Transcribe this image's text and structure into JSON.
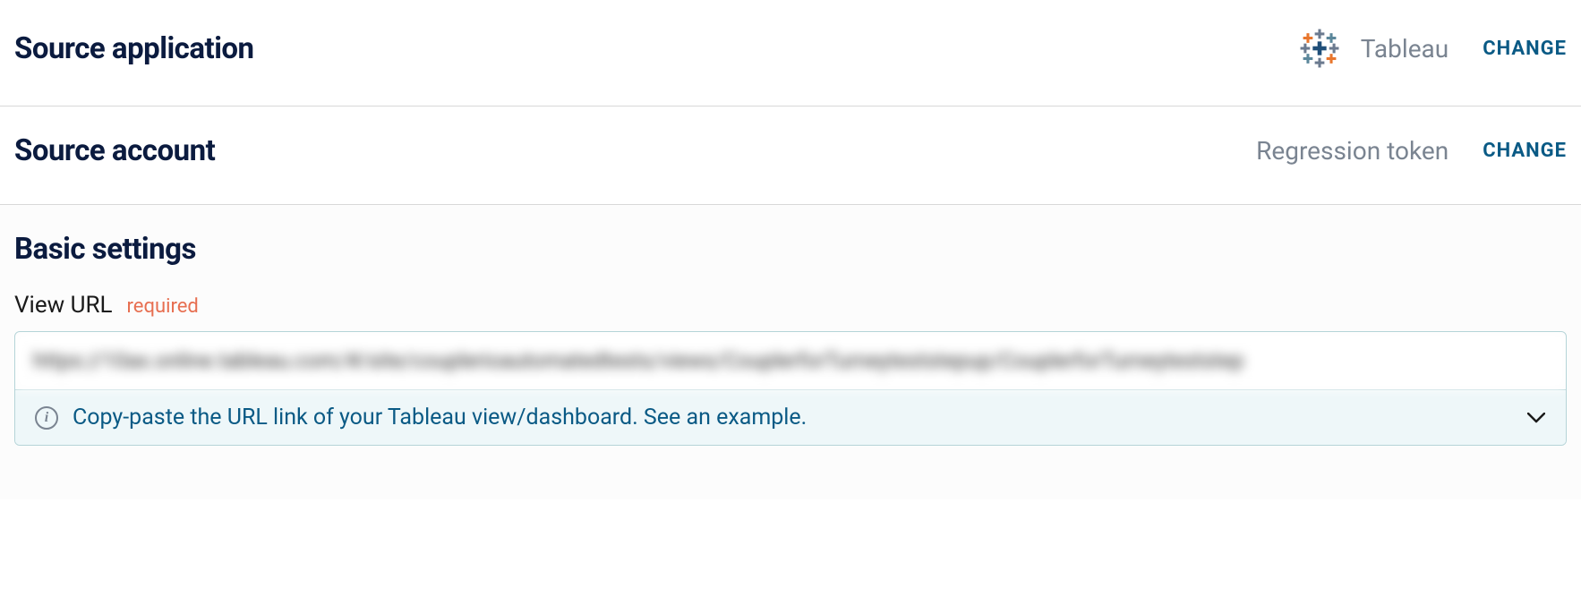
{
  "sourceApplication": {
    "heading": "Source application",
    "value": "Tableau",
    "changeLabel": "CHANGE"
  },
  "sourceAccount": {
    "heading": "Source account",
    "value": "Regression token",
    "changeLabel": "CHANGE"
  },
  "basicSettings": {
    "heading": "Basic settings",
    "viewUrl": {
      "label": "View URL",
      "required": "required",
      "value": "https://10ax.online.tableau.com/#/site/couplerioautomatedtests/views/CouplerforTurneyteststepup/CouplerforTurneyteststep",
      "hint": "Copy-paste the URL link of your Tableau view/dashboard. See an example."
    }
  }
}
